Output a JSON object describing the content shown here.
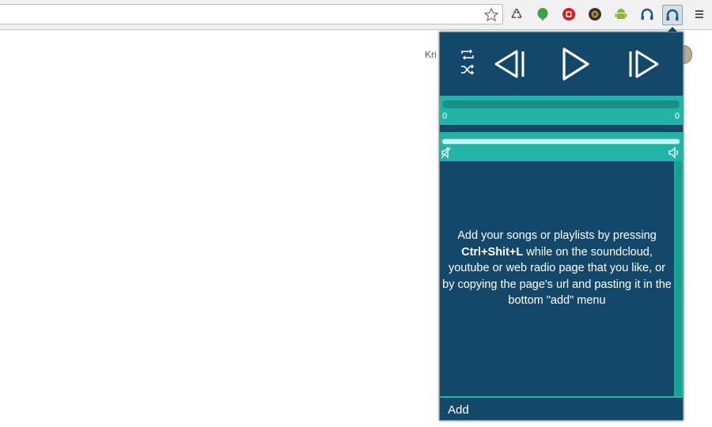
{
  "browser": {
    "extensions": [
      {
        "name": "recycle-icon",
        "color": "#555555"
      },
      {
        "name": "evernote-icon",
        "color": "#3fa14b"
      },
      {
        "name": "stop-icon",
        "color": "#cc2222"
      },
      {
        "name": "camera-icon",
        "color": "#333333"
      },
      {
        "name": "android-icon",
        "color": "#8ab833"
      },
      {
        "name": "headphones-icon",
        "color": "#1f5c80"
      },
      {
        "name": "headphones-active-icon",
        "color": "#1f5c80"
      }
    ]
  },
  "page": {
    "partial_text": "Kri"
  },
  "player": {
    "progress": {
      "current_time": "0",
      "total_time": "0",
      "fraction": 0
    },
    "volume": {
      "fraction": 1
    },
    "empty_message": {
      "before": "Add your songs or playlists by pressing ",
      "shortcut": "Ctrl+Shit+L",
      "after": " while on the soundcloud, youtube or web radio page that you like, or by copying the page's url and pasting it in the bottom \"add\" menu"
    },
    "footer": {
      "add_label": "Add"
    },
    "colors": {
      "panel_dark": "#13486a",
      "accent_teal": "#22b5a7",
      "track": "#1a8f86"
    }
  }
}
